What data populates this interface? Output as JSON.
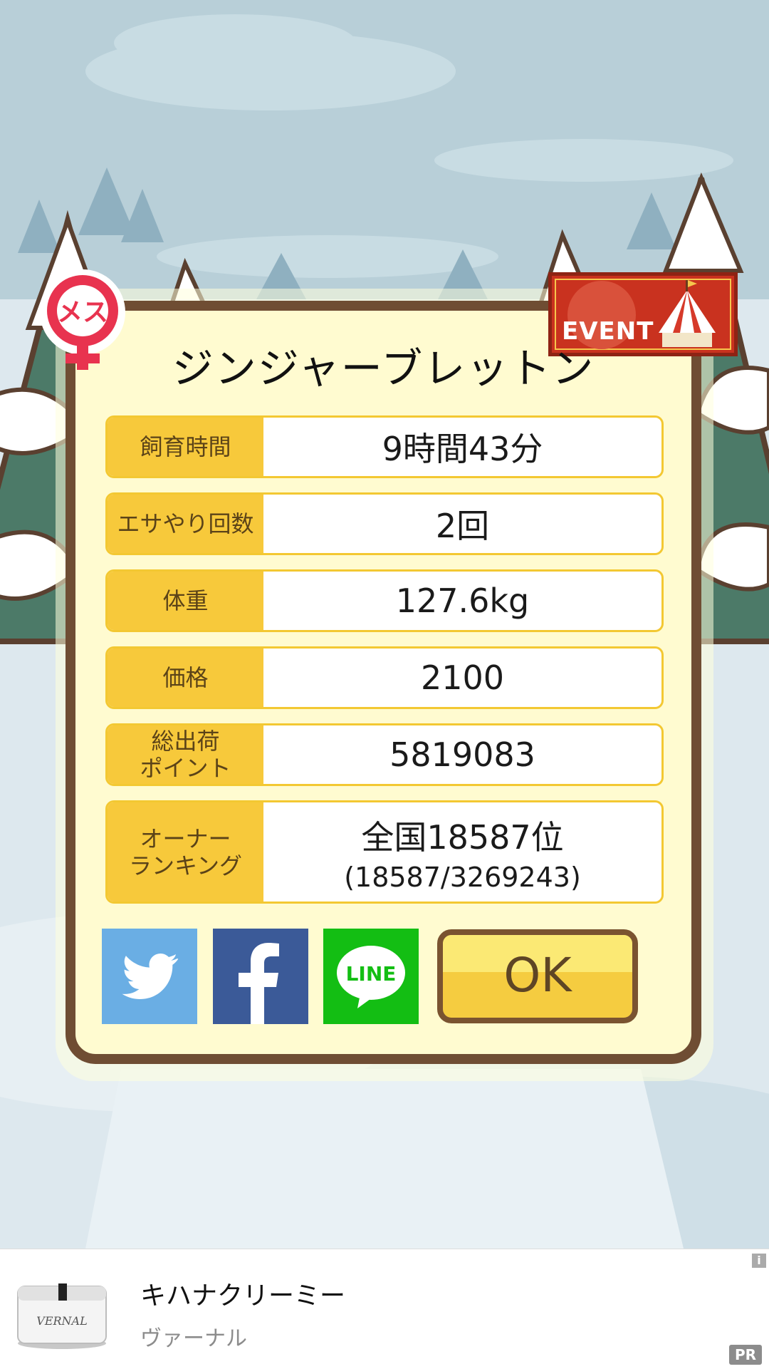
{
  "pig": {
    "gender": "メス",
    "name": "ジンジャーブレットン",
    "event_label": "EVENT"
  },
  "stats": [
    {
      "label": "飼育時間",
      "value": "9時間43分"
    },
    {
      "label": "エサやり回数",
      "value": "2回"
    },
    {
      "label": "体重",
      "value": "127.6kg"
    },
    {
      "label": "価格",
      "value": "2100"
    },
    {
      "label": "総出荷\nポイント",
      "value": "5819083"
    },
    {
      "label": "オーナー\nランキング",
      "value": "全国18587位",
      "sub": "(18587/3269243)"
    }
  ],
  "share": {
    "twitter_icon": "twitter-bird-icon",
    "facebook_icon": "facebook-f-icon",
    "line_label": "LINE"
  },
  "ok_label": "OK",
  "ad": {
    "title": "キハナクリーミー",
    "advertiser": "ヴァーナル",
    "info_icon": "i",
    "pr_label": "PR",
    "product_brand": "VERNAL"
  },
  "colors": {
    "frame": "#6f4d33",
    "label_bg": "#f7c93b",
    "twitter": "#6aaee4",
    "facebook": "#3b5a98",
    "line": "#13be13",
    "event_bg": "#c9321f",
    "gender": "#e8334f"
  }
}
